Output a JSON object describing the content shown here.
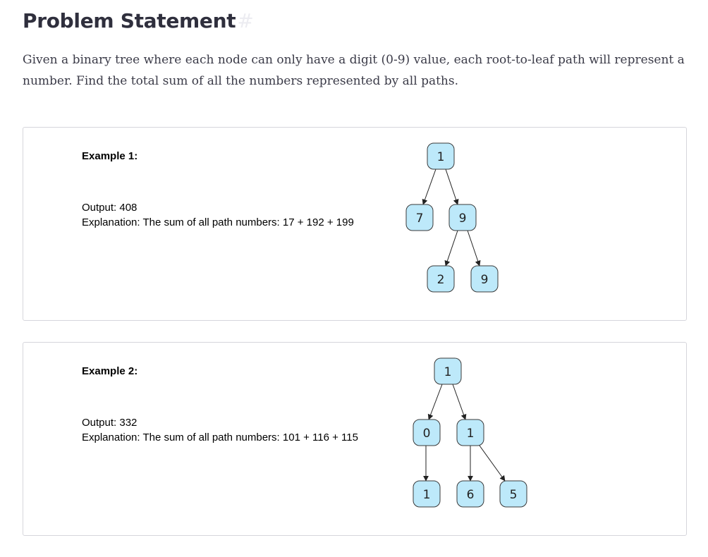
{
  "heading": {
    "title": "Problem Statement",
    "anchor": "#"
  },
  "statement": "Given a binary tree where each node can only have a digit (0-9) value, each root-to-leaf path will represent a number. Find the total sum of all the numbers represented by all paths.",
  "examples": [
    {
      "title": "Example 1:",
      "output": "Output: 408",
      "explanation": "Explanation: The sum of all path numbers: 17 + 192 + 199",
      "tree": {
        "root": "1",
        "left": "7",
        "right": "9",
        "right_left": "2",
        "right_right": "9"
      }
    },
    {
      "title": "Example 2:",
      "output": "Output: 332",
      "explanation": "Explanation: The sum of all path numbers: 101 + 116 + 115",
      "tree": {
        "root": "1",
        "left": "0",
        "right": "1",
        "left_child": "1",
        "right_left": "6",
        "right_right": "5"
      }
    }
  ],
  "colors": {
    "node_fill": "#bde9fa",
    "node_border": "#3a3a3a"
  }
}
